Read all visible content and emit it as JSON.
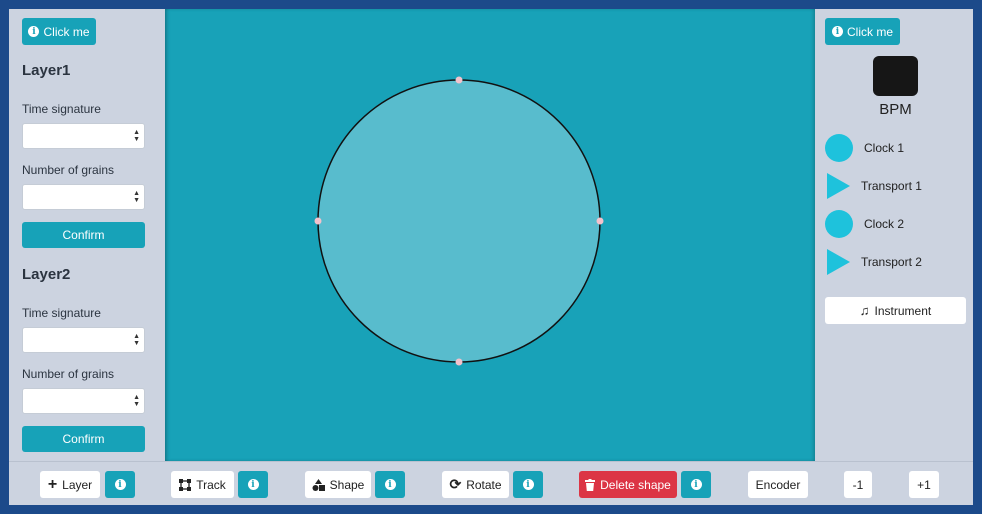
{
  "left_panel": {
    "click_me_label": "Click me",
    "layers": [
      {
        "title": "Layer1",
        "time_signature_label": "Time signature",
        "grains_label": "Number of grains",
        "confirm_label": "Confirm"
      },
      {
        "title": "Layer2",
        "time_signature_label": "Time signature",
        "grains_label": "Number of grains",
        "confirm_label": "Confirm"
      }
    ]
  },
  "right_panel": {
    "click_me_label": "Click me",
    "bpm_label": "BPM",
    "items": [
      {
        "label": "Clock 1",
        "icon": "circle"
      },
      {
        "label": "Transport 1",
        "icon": "play-triangle"
      },
      {
        "label": "Clock 2",
        "icon": "circle"
      },
      {
        "label": "Transport 2",
        "icon": "play-triangle"
      }
    ],
    "instrument_label": "Instrument"
  },
  "toolbar": {
    "layer_label": "Layer",
    "track_label": "Track",
    "shape_label": "Shape",
    "rotate_label": "Rotate",
    "delete_shape_label": "Delete shape",
    "encoder_label": "Encoder",
    "minus_label": "-1",
    "plus_label": "+1"
  },
  "colors": {
    "accent": "#17a2b8",
    "canvas_bg": "#18a2b8",
    "circle_fill": "#58bccd",
    "danger": "#dc3545",
    "panel_bg": "#ccd3e0",
    "control_point": "#f4c2cc"
  }
}
